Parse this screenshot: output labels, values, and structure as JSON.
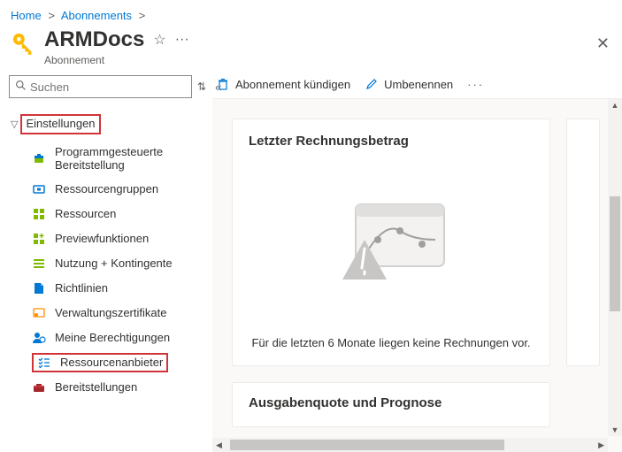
{
  "breadcrumb": {
    "home": "Home",
    "level2": "Abonnements"
  },
  "header": {
    "title": "ARMDocs",
    "subtitle": "Abonnement"
  },
  "search": {
    "placeholder": "Suchen"
  },
  "nav": {
    "group_label": "Einstellungen",
    "items": [
      {
        "label": "Programmgesteuerte Bereitstellung",
        "icon": "deploy"
      },
      {
        "label": "Ressourcengruppen",
        "icon": "resourcegroups"
      },
      {
        "label": "Ressourcen",
        "icon": "resources"
      },
      {
        "label": "Previewfunktionen",
        "icon": "preview"
      },
      {
        "label": "Nutzung + Kontingente",
        "icon": "usage"
      },
      {
        "label": "Richtlinien",
        "icon": "policy"
      },
      {
        "label": "Verwaltungszertifikate",
        "icon": "certs"
      },
      {
        "label": "Meine Berechtigungen",
        "icon": "perms"
      },
      {
        "label": "Ressourcenanbieter",
        "icon": "providers",
        "highlighted": true
      },
      {
        "label": "Bereitstellungen",
        "icon": "deployments"
      }
    ]
  },
  "commands": {
    "cancel": "Abonnement kündigen",
    "rename": "Umbenennen"
  },
  "cards": {
    "billing_title": "Letzter Rechnungsbetrag",
    "billing_empty": "Für die letzten 6 Monate liegen keine Rechnungen vor.",
    "forecast_title": "Ausgabenquote und Prognose"
  }
}
